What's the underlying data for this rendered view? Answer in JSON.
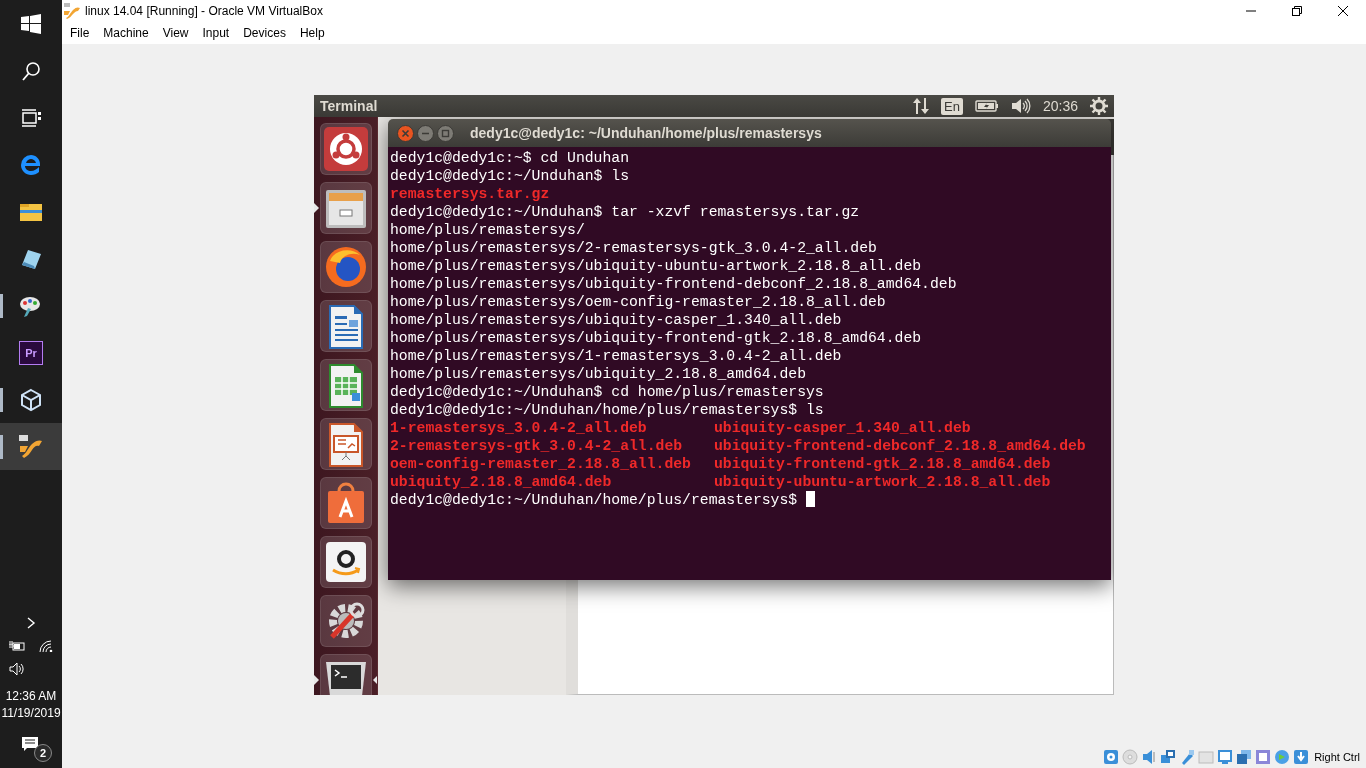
{
  "vbox": {
    "title": "linux 14.04 [Running] - Oracle VM VirtualBox",
    "menu": [
      "File",
      "Machine",
      "View",
      "Input",
      "Devices",
      "Help"
    ],
    "host_key": "Right Ctrl"
  },
  "ubuntu_panel": {
    "app_title": "Terminal",
    "keyboard": "En",
    "clock": "20:36"
  },
  "launcher": [
    {
      "kind": "ubuntu",
      "running": false,
      "focused": false
    },
    {
      "kind": "files",
      "running": true,
      "focused": false
    },
    {
      "kind": "firefox",
      "running": false,
      "focused": false
    },
    {
      "kind": "writer",
      "running": false,
      "focused": false
    },
    {
      "kind": "calc",
      "running": false,
      "focused": false
    },
    {
      "kind": "impress",
      "running": false,
      "focused": false
    },
    {
      "kind": "software",
      "running": false,
      "focused": false
    },
    {
      "kind": "amazon",
      "running": false,
      "focused": false
    },
    {
      "kind": "settings",
      "running": false,
      "focused": false
    },
    {
      "kind": "terminal",
      "running": true,
      "focused": true
    }
  ],
  "terminal": {
    "title": "dedy1c@dedy1c: ~/Unduhan/home/plus/remastersys",
    "cursor": true,
    "lines": [
      {
        "kind": "text",
        "cells": [
          "dedy1c@dedy1c:~$ cd Unduhan"
        ]
      },
      {
        "kind": "text",
        "cells": [
          "dedy1c@dedy1c:~/Unduhan$ ls"
        ]
      },
      {
        "kind": "files",
        "cells": [
          "remastersys.tar.gz"
        ]
      },
      {
        "kind": "text",
        "cells": [
          "dedy1c@dedy1c:~/Unduhan$ tar -xzvf remastersys.tar.gz"
        ]
      },
      {
        "kind": "text",
        "cells": [
          "home/plus/remastersys/"
        ]
      },
      {
        "kind": "text",
        "cells": [
          "home/plus/remastersys/2-remastersys-gtk_3.0.4-2_all.deb"
        ]
      },
      {
        "kind": "text",
        "cells": [
          "home/plus/remastersys/ubiquity-ubuntu-artwork_2.18.8_all.deb"
        ]
      },
      {
        "kind": "text",
        "cells": [
          "home/plus/remastersys/ubiquity-frontend-debconf_2.18.8_amd64.deb"
        ]
      },
      {
        "kind": "text",
        "cells": [
          "home/plus/remastersys/oem-config-remaster_2.18.8_all.deb"
        ]
      },
      {
        "kind": "text",
        "cells": [
          "home/plus/remastersys/ubiquity-casper_1.340_all.deb"
        ]
      },
      {
        "kind": "text",
        "cells": [
          "home/plus/remastersys/ubiquity-frontend-gtk_2.18.8_amd64.deb"
        ]
      },
      {
        "kind": "text",
        "cells": [
          "home/plus/remastersys/1-remastersys_3.0.4-2_all.deb"
        ]
      },
      {
        "kind": "text",
        "cells": [
          "home/plus/remastersys/ubiquity_2.18.8_amd64.deb"
        ]
      },
      {
        "kind": "text",
        "cells": [
          "dedy1c@dedy1c:~/Unduhan$ cd home/plus/remastersys"
        ]
      },
      {
        "kind": "text",
        "cells": [
          "dedy1c@dedy1c:~/Unduhan/home/plus/remastersys$ ls"
        ]
      },
      {
        "kind": "files",
        "cells": [
          "1-remastersys_3.0.4-2_all.deb",
          "ubiquity-casper_1.340_all.deb"
        ]
      },
      {
        "kind": "files",
        "cells": [
          "2-remastersys-gtk_3.0.4-2_all.deb",
          "ubiquity-frontend-debconf_2.18.8_amd64.deb"
        ]
      },
      {
        "kind": "files",
        "cells": [
          "oem-config-remaster_2.18.8_all.deb",
          "ubiquity-frontend-gtk_2.18.8_amd64.deb"
        ]
      },
      {
        "kind": "files",
        "cells": [
          "ubiquity_2.18.8_amd64.deb",
          "ubiquity-ubuntu-artwork_2.18.8_all.deb"
        ]
      },
      {
        "kind": "text",
        "cells": [
          "dedy1c@dedy1c:~/Unduhan/home/plus/remastersys$"
        ]
      }
    ]
  },
  "taskbar": {
    "apps": [
      {
        "kind": "edge",
        "running": false,
        "selected": false
      },
      {
        "kind": "explorer",
        "running": false,
        "selected": false
      },
      {
        "kind": "glass",
        "running": false,
        "selected": false
      },
      {
        "kind": "paint",
        "running": true,
        "selected": false
      },
      {
        "kind": "premiere",
        "label": "Pr",
        "running": false,
        "selected": false
      },
      {
        "kind": "cube",
        "running": true,
        "selected": false
      },
      {
        "kind": "vm",
        "running": true,
        "selected": true
      }
    ],
    "time": "12:36 AM",
    "date": "11/19/2019",
    "notifications": "2"
  }
}
